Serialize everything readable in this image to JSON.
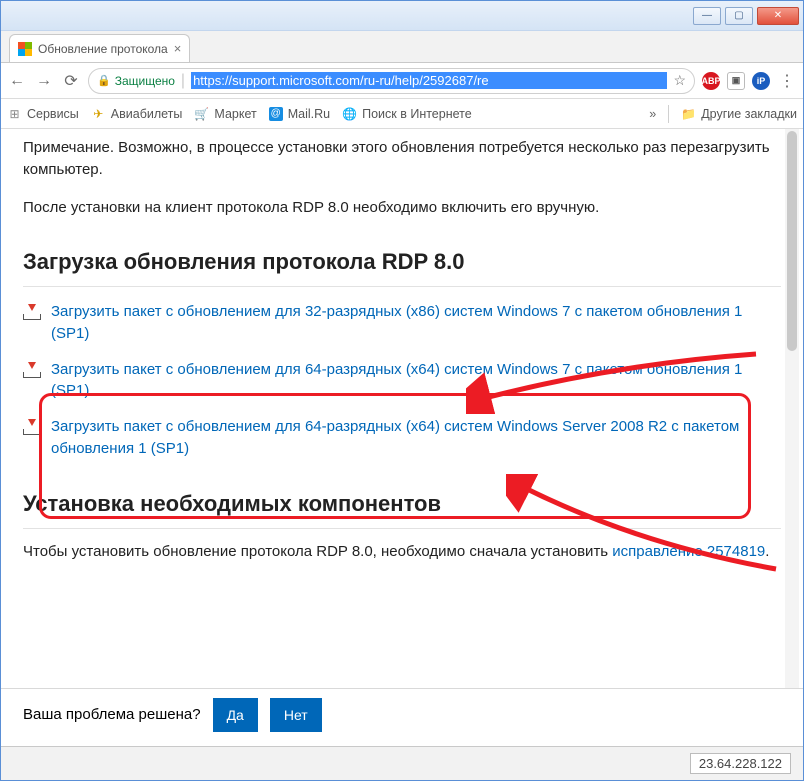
{
  "window": {
    "minimize_glyph": "—",
    "maximize_glyph": "▢",
    "close_glyph": "✕"
  },
  "tab": {
    "title": "Обновление протокола",
    "close_glyph": "×"
  },
  "address": {
    "secure_label": "Защищено",
    "url_selected": "https://support.microsoft.com/ru-ru/help/2592687/re",
    "abp_label": "ABP",
    "ip_label": "iP"
  },
  "bookmarks": {
    "apps": "Сервисы",
    "flights": "Авиабилеты",
    "market": "Маркет",
    "mailru": "Mail.Ru",
    "search": "Поиск в Интернете",
    "overflow_glyph": "»",
    "other": "Другие закладки"
  },
  "page": {
    "note": "Примечание. Возможно, в процессе установки этого обновления потребуется несколько раз перезагрузить компьютер.",
    "after_install": "После установки на клиент протокола RDP 8.0 необходимо включить его вручную.",
    "h_download": "Загрузка обновления протокола RDP 8.0",
    "link_x86": "Загрузить пакет с обновлением для 32-разрядных (x86) систем Windows 7 с пакетом обновления 1 (SP1)",
    "link_x64": "Загрузить пакет с обновлением для 64-разрядных (x64) систем Windows 7 с пакетом обновления 1 (SP1)",
    "link_srv": "Загрузить пакет с обновлением для 64-разрядных (x64) систем Windows Server 2008 R2 с пакетом обновления 1 (SP1)",
    "h_install": "Установка необходимых компонентов",
    "install_pre": "Чтобы установить обновление протокола RDP 8.0, необходимо сначала установить ",
    "install_link": "исправление 2574819",
    "install_post": "."
  },
  "feedback": {
    "question": "Ваша проблема решена?",
    "yes": "Да",
    "no": "Нет"
  },
  "status": {
    "ip": "23.64.228.122"
  }
}
